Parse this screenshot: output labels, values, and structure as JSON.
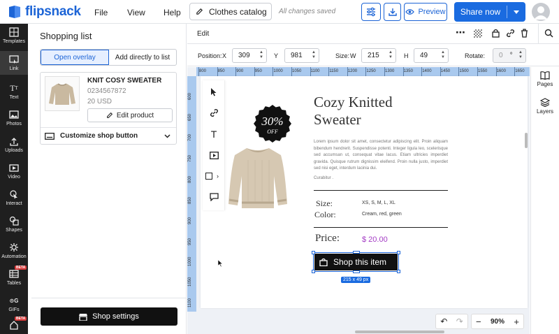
{
  "app": {
    "logo_text": "flipsnack",
    "menu": [
      "File",
      "View",
      "Help"
    ],
    "doc_title": "Clothes catalog",
    "save_status": "All changes saved",
    "preview_label": "Preview",
    "share_label": "Share now"
  },
  "colors": {
    "primary": "#1a6be0",
    "rail_bg": "#1f1f1f",
    "ruler": "#a9c9ee",
    "price": "#a33bc4"
  },
  "rail": [
    {
      "label": "Templates",
      "icon": "templates-icon"
    },
    {
      "label": "Link",
      "icon": "link-icon",
      "active": true
    },
    {
      "label": "Text",
      "icon": "text-icon"
    },
    {
      "label": "Photos",
      "icon": "photos-icon"
    },
    {
      "label": "Uploads",
      "icon": "upload-icon"
    },
    {
      "label": "Video",
      "icon": "video-icon"
    },
    {
      "label": "Interact",
      "icon": "interact-icon"
    },
    {
      "label": "Shapes",
      "icon": "shapes-icon"
    },
    {
      "label": "Automation",
      "icon": "automation-icon"
    },
    {
      "label": "Tables",
      "icon": "tables-icon",
      "badge": "BETA"
    },
    {
      "label": "GIFs",
      "icon": "gifs-icon"
    },
    {
      "label": "",
      "icon": "home-icon",
      "badge": "BETA"
    }
  ],
  "panel": {
    "title": "Shopping list",
    "tab_overlay": "Open overlay",
    "tab_direct": "Add directly to list",
    "product": {
      "name": "KNIT COSY SWEATER",
      "sku": "0234567872",
      "price": "20 USD",
      "edit_label": "Edit product"
    },
    "customize_label": "Customize shop button",
    "shop_settings_label": "Shop settings"
  },
  "editbar": {
    "label": "Edit"
  },
  "position": {
    "pos_label": "Position:",
    "x_label": "X",
    "x": "309",
    "y_label": "Y",
    "y": "981",
    "size_label": "Size:",
    "w_label": "W",
    "w": "215",
    "h_label": "H",
    "h": "49",
    "rotate_label": "Rotate:",
    "rotate": "0",
    "rotate_unit": "°"
  },
  "ruler_h": [
    "800",
    "850",
    "900",
    "950",
    "1000",
    "1050",
    "1100",
    "1150",
    "1200",
    "1250",
    "1300",
    "1350",
    "1400",
    "1450",
    "1500",
    "1550",
    "1600",
    "1650"
  ],
  "ruler_v": [
    "600",
    "650",
    "700",
    "750",
    "800",
    "850",
    "900",
    "950",
    "1000",
    "1050",
    "1100",
    "1150"
  ],
  "page": {
    "badge_big": "30%",
    "badge_small": "OFF",
    "title_line1": "Cozy Knitted",
    "title_line2": "Sweater",
    "lorem": "Lorem ipsum dolor sit amet, consectetur adipiscing elit. Proin aliquam bibendum hendrerit. Suspendisse potenti. Integer ligula leo, scelerisque sed accumsan ut, consequat vitae lacus. Etiam ultricies imperdiet gravida. Quisque rutrum dignissim eleifend. Proin nulla justo, imperdiet sed nisi eget, interdum lacinia dui.",
    "curabitur": "Curabitur .",
    "size_label": "Size:",
    "size_value": "XS, S, M, L, XL",
    "color_label": "Color:",
    "color_value": "Cream, red, green",
    "price_label": "Price:",
    "price_value": "$ 20.00",
    "button_label": "Shop this item",
    "dimension_tag": "215 x 49 px"
  },
  "right_rail": {
    "pages": "Pages",
    "layers": "Layers"
  },
  "zoom": {
    "value": "90%",
    "minus": "−",
    "plus": "+"
  }
}
